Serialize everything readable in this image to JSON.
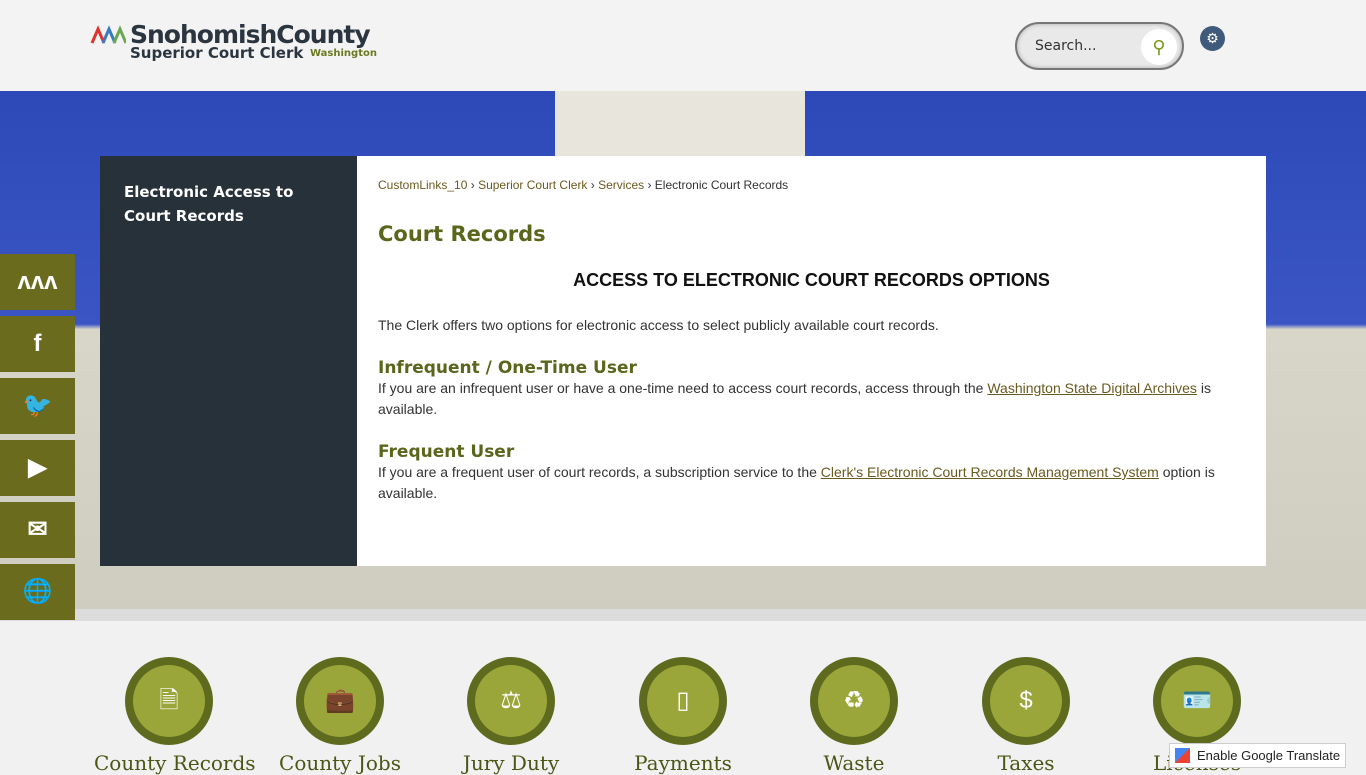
{
  "header": {
    "logo": {
      "line1": "SnohomishCounty",
      "line2": "Superior Court Clerk",
      "line3": "Washington"
    },
    "search_placeholder": "Search...",
    "search_icon": "search-icon",
    "settings_icon": "gear-icon"
  },
  "sidebar": {
    "item": "Electronic Access to Court Records"
  },
  "breadcrumb": [
    {
      "label": "CustomLinks_10"
    },
    {
      "label": "Superior Court Clerk"
    },
    {
      "label": "Services"
    },
    {
      "label": "Electronic Court Records"
    }
  ],
  "content": {
    "title": "Court Records",
    "heading": "ACCESS TO ELECTRONIC COURT RECORDS OPTIONS",
    "intro": "The Clerk offers two options for electronic access to select publicly available court records.",
    "s1": {
      "title": "Infrequent / One-Time User",
      "pre": "If you are an infrequent user or have a one-time need to access court records, access through the ",
      "link": "Washington State Digital Archives",
      "post": " is available."
    },
    "s2": {
      "title": "Frequent User",
      "pre": "If you are a frequent user of court records, a subscription service to the ",
      "link": "Clerk's Electronic Court Records Management System",
      "post": " option is available."
    }
  },
  "social": [
    "county-logo",
    "facebook",
    "twitter",
    "youtube",
    "email",
    "translate"
  ],
  "tiles": [
    {
      "label": "County Records",
      "icon": "document-icon"
    },
    {
      "label": "County Jobs",
      "icon": "briefcase-icon"
    },
    {
      "label": "Jury Duty",
      "icon": "gavel-icon"
    },
    {
      "label": "Payments",
      "icon": "mouse-icon"
    },
    {
      "label": "Waste",
      "icon": "recycle-icon"
    },
    {
      "label": "Taxes",
      "icon": "house-dollar-icon"
    },
    {
      "label": "Licenses",
      "icon": "id-card-icon"
    }
  ],
  "translate": "Enable Google Translate",
  "colors": {
    "accent": "#5b651c",
    "sidebar": "#27313a",
    "tile": "#9aa63a"
  }
}
